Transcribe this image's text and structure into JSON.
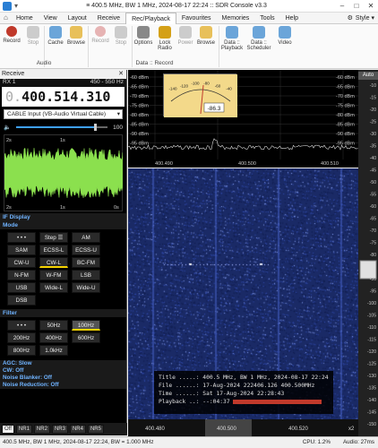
{
  "window": {
    "title": "≡ 400.5 MHz, BW 1 MHz, 2024-08-17 22:24 :: SDR Console v3.3",
    "buttons": [
      "–",
      "□",
      "✕"
    ]
  },
  "menu": {
    "tabs": [
      "Home",
      "View",
      "Layout",
      "Receive",
      "Rec/Playback",
      "Favourites",
      "Memories",
      "Tools",
      "Help"
    ],
    "active": "Rec/Playback",
    "style_label": "Style"
  },
  "ribbon": {
    "audio_buttons": [
      "Record",
      "Stop",
      "Cache",
      "Browse"
    ],
    "data_buttons": [
      "Record",
      "Stop",
      "Options",
      "Lock Radio",
      "Power",
      "Browse"
    ],
    "extra_buttons": [
      "Data :: Playback",
      "Data :: Scheduler",
      "Video"
    ],
    "group_audio": "Audio",
    "group_data": "Data :: Record"
  },
  "receive": {
    "header": "Receive",
    "rx": "RX 1",
    "range": "450 - 550 Hz",
    "freq_dim": "0.",
    "freq": "400.514.310",
    "input": "CABLE Input (VB-Audio Virtual Cable)",
    "volume_value": "100",
    "volume_fraction": 0.85,
    "scope_top_labels": [
      "2s",
      "1s"
    ],
    "scope_bottom_labels": [
      "2s",
      "1s",
      "0s"
    ],
    "if_display": "IF Display",
    "mode_header": "Mode",
    "modes": [
      "• • •",
      "Step ☰",
      "AM",
      "SAM",
      "ECSS-L",
      "ECSS-U",
      "CW-U",
      "CW-L",
      "BC-FM",
      "N-FM",
      "W-FM",
      "LSB",
      "USB",
      "Wide-L",
      "Wide-U",
      "DSB"
    ],
    "selected_mode": "CW-L",
    "filter_header": "Filter",
    "filters": [
      "• • •",
      "50Hz",
      "100Hz",
      "200Hz",
      "400Hz",
      "600Hz",
      "800Hz",
      "1.0kHz"
    ],
    "selected_filter": "100Hz",
    "agc": "AGC: Slow",
    "cw": "CW: Off",
    "noise_blanker": "Noise Blanker: Off",
    "noise_reduction": "Noise Reduction: Off",
    "nr_buttons": [
      "Off",
      "NR1",
      "NR2",
      "NR3",
      "NR4",
      "NR5"
    ]
  },
  "spectrum": {
    "left_db": [
      "-60 dBm",
      "-65 dBm",
      "-70 dBm",
      "-75 dBm",
      "-80 dBm",
      "-85 dBm",
      "-90 dBm",
      "-95 dBm"
    ],
    "right_db": [
      "-60 dBm",
      "-65 dBm",
      "-70 dBm",
      "-75 dBm",
      "-80 dBm",
      "-85 dBm",
      "-90 dBm",
      "-95 dBm"
    ],
    "freq_labels": [
      "400.490",
      "400.500",
      "400.510"
    ],
    "meter_value": "-86.3",
    "meter_scale": [
      "-140",
      "-120",
      "-100",
      "-80",
      "-60",
      "-40"
    ],
    "auto_label": "Auto",
    "right_axis": [
      "-10",
      "-15",
      "-20",
      "-25",
      "-30",
      "-35",
      "-40",
      "-45",
      "-50",
      "-55",
      "-60",
      "-65",
      "-70",
      "-75",
      "-80",
      "-85",
      "-90",
      "-95",
      "-100",
      "-105",
      "-110",
      "-115",
      "-120",
      "-125",
      "-130",
      "-135",
      "-140",
      "-145",
      "-150"
    ]
  },
  "waterfall": {
    "freq_labels": [
      "400.480",
      "400.500",
      "400.520"
    ],
    "zoom": "x2",
    "info_title": "Title .....: 400.5 MHz, BW 1 MHz, 2024-08-17 22:24",
    "info_file": "File ......: 17-Aug-2024 222406.126 400.500MHz",
    "info_time": "Time ......: Sat 17-Aug-2024 22:28:43",
    "info_playback": "Playback ..: --:04:37",
    "playback_fraction": 0.55
  },
  "status": {
    "left": "400.5 MHz, BW 1 MHz, 2024-08-17 22:24, BW = 1.000 MHz",
    "cpu": "CPU: 1.2%",
    "audio": "Audio: 27ms"
  }
}
